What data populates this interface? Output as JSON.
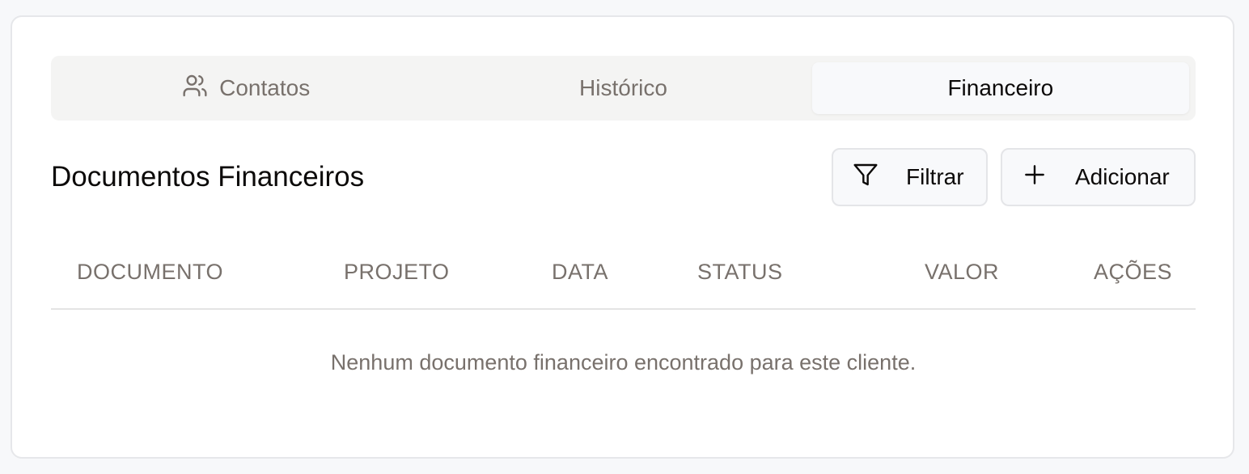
{
  "tabs": [
    {
      "label": "Contatos",
      "icon": "users-icon",
      "active": false
    },
    {
      "label": "Histórico",
      "active": false
    },
    {
      "label": "Financeiro",
      "active": true
    }
  ],
  "section": {
    "title": "Documentos Financeiros"
  },
  "actions": {
    "filter_label": "Filtrar",
    "filter_icon": "filter-icon",
    "add_label": "Adicionar",
    "add_icon": "plus-icon"
  },
  "table": {
    "columns": [
      "DOCUMENTO",
      "PROJETO",
      "DATA",
      "STATUS",
      "VALOR",
      "AÇÕES"
    ],
    "empty_message": "Nenhum documento financeiro encontrado para este cliente."
  },
  "colors": {
    "text_primary": "#0c0a09",
    "text_muted": "#78716c",
    "tab_bar_bg": "#f4f4f3"
  }
}
